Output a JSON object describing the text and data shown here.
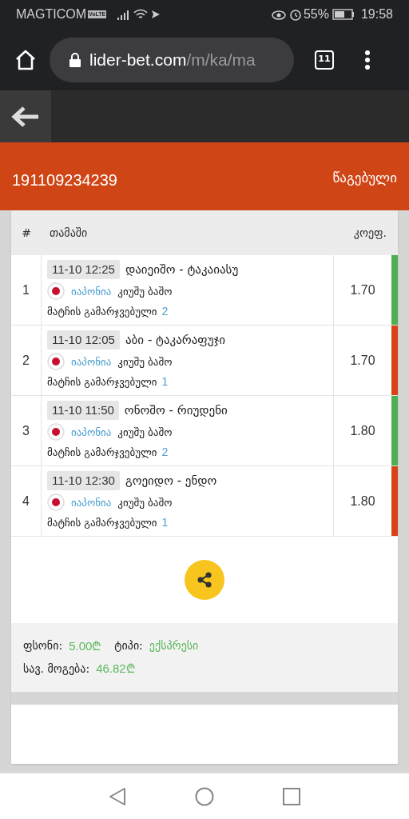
{
  "status_bar": {
    "carrier": "MAGTICOM",
    "volte": "VoLTE",
    "battery": "55%",
    "time": "19:58"
  },
  "browser": {
    "url_host": "lider-bet.com",
    "url_path": "/m/ka/ma",
    "tab_count": "11"
  },
  "ticket": {
    "id": "191109234239",
    "status": "წაგებული"
  },
  "table": {
    "columns": [
      "#",
      "თამაში",
      "კოეფ."
    ],
    "rows": [
      {
        "number": "1",
        "time": "11-10 12:25",
        "match": "დაიეიშო - ტაკაიასუ",
        "country": "იაპონია",
        "league": "კიუშუ ბაშო",
        "market": "მატჩის გამარჯვებული",
        "pick": "2",
        "odds": "1.70",
        "color": "#4caf50"
      },
      {
        "number": "2",
        "time": "11-10 12:05",
        "match": "აბი - ტაკარაფუჯი",
        "country": "იაპონია",
        "league": "კიუშუ ბაშო",
        "market": "მატჩის გამარჯვებული",
        "pick": "1",
        "odds": "1.70",
        "color": "#d84315"
      },
      {
        "number": "3",
        "time": "11-10 11:50",
        "match": "ონოშო - რიუდენი",
        "country": "იაპონია",
        "league": "კიუშუ ბაშო",
        "market": "მატჩის გამარჯვებული",
        "pick": "2",
        "odds": "1.80",
        "color": "#4caf50"
      },
      {
        "number": "4",
        "time": "11-10 12:30",
        "match": "გოეიდო - ენდო",
        "country": "იაპონია",
        "league": "კიუშუ ბაშო",
        "market": "მატჩის გამარჯვებული",
        "pick": "1",
        "odds": "1.80",
        "color": "#d84315"
      }
    ]
  },
  "summary": {
    "stake_label": "ფსონი:",
    "stake": "5.00",
    "currency": "₾",
    "type_label": "ტიპი:",
    "type": "ექსპრესი",
    "win_label": "სავ. მოგება:",
    "win": "46.82"
  }
}
